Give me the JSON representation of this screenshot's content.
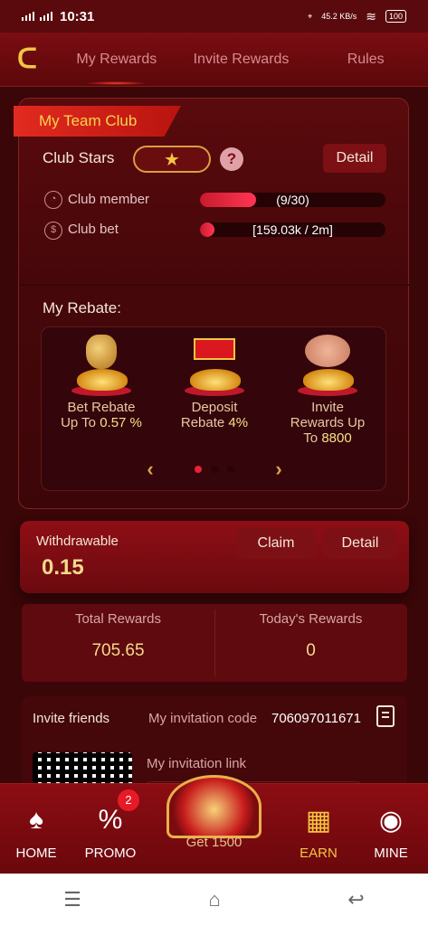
{
  "status_bar": {
    "time": "10:31",
    "speed": "45.2 KB/s",
    "battery": "100"
  },
  "header": {
    "tabs": [
      {
        "label": "My Rewards"
      },
      {
        "label": "Invite Rewards"
      },
      {
        "label": "Rules"
      }
    ]
  },
  "team_club": {
    "title": "My Team Club",
    "club_stars_label": "Club Stars",
    "detail_label": "Detail",
    "member": {
      "label": "Club member",
      "text": "(9/30)",
      "progress": 0.3
    },
    "bet": {
      "label": "Club bet",
      "text": "[159.03k / 2m]",
      "progress": 0.08
    }
  },
  "rebate": {
    "title": "My Rebate:",
    "items": [
      {
        "line1": "Bet Rebate",
        "line2a": "Up To ",
        "line2b": "0.57 %",
        "line3": ""
      },
      {
        "line1": "Deposit",
        "line2a": "Rebate ",
        "line2b": "4%",
        "line3": ""
      },
      {
        "line1": "Invite",
        "line2a": "Rewards Up",
        "line2b": "",
        "line3a": "To ",
        "line3b": "8800"
      }
    ]
  },
  "withdraw": {
    "label": "Withdrawable",
    "value": "0.15",
    "claim_label": "Claim",
    "detail_label": "Detail"
  },
  "totals": {
    "total_label": "Total Rewards",
    "total_value": "705.65",
    "today_label": "Today's Rewards",
    "today_value": "0"
  },
  "invite": {
    "title": "Invite friends",
    "code_label": "My invitation code",
    "code": "706097011671",
    "link_label": "My invitation link"
  },
  "bottom_nav": {
    "home": "HOME",
    "promo": "PROMO",
    "promo_badge": "2",
    "get": "Get 1500",
    "earn": "EARN",
    "mine": "MINE"
  }
}
